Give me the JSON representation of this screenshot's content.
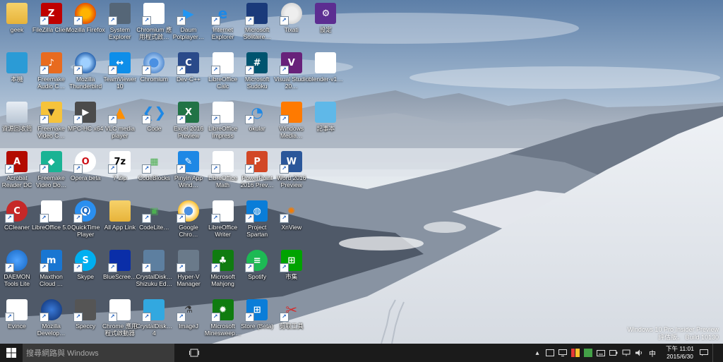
{
  "desktop_icons": [
    {
      "label": "geek",
      "kind": "folder",
      "col": 0,
      "row": 0,
      "shortcut": false
    },
    {
      "label": "FileZilla Client",
      "kind": "filezilla",
      "col": 1,
      "row": 0,
      "shortcut": true
    },
    {
      "label": "Mozilla Firefox",
      "kind": "firefox",
      "col": 2,
      "row": 0,
      "shortcut": true
    },
    {
      "label": "System Explorer",
      "kind": "sysexp",
      "col": 3,
      "row": 0,
      "shortcut": true
    },
    {
      "label": "Chromium 應用程式啟…",
      "kind": "grid",
      "col": 4,
      "row": 0,
      "shortcut": true
    },
    {
      "label": "Daum Potplayer…",
      "kind": "play",
      "col": 5,
      "row": 0,
      "shortcut": true
    },
    {
      "label": "Internet Explorer",
      "kind": "ie",
      "col": 6,
      "row": 0,
      "shortcut": true
    },
    {
      "label": "Microsoft Solitaire…",
      "kind": "cards",
      "col": 7,
      "row": 0,
      "shortcut": true
    },
    {
      "label": "Tixati",
      "kind": "tixati",
      "col": 8,
      "row": 0,
      "shortcut": true
    },
    {
      "label": "設定",
      "kind": "gear",
      "col": 9,
      "row": 0,
      "shortcut": false
    },
    {
      "label": "本機",
      "kind": "pc",
      "col": 0,
      "row": 1,
      "shortcut": false
    },
    {
      "label": "Freemake Audio C…",
      "kind": "freemake-audio",
      "col": 1,
      "row": 1,
      "shortcut": true
    },
    {
      "label": "Mozilla Thunderbird",
      "kind": "thunderbird",
      "col": 2,
      "row": 1,
      "shortcut": true
    },
    {
      "label": "TeamViewer 10",
      "kind": "teamviewer",
      "col": 3,
      "row": 1,
      "shortcut": true
    },
    {
      "label": "Chromium",
      "kind": "chromium",
      "col": 4,
      "row": 1,
      "shortcut": true
    },
    {
      "label": "Dev-C++",
      "kind": "devcpp",
      "col": 5,
      "row": 1,
      "shortcut": true
    },
    {
      "label": "LibreOffice Calc",
      "kind": "calc",
      "col": 6,
      "row": 1,
      "shortcut": true
    },
    {
      "label": "Microsoft Sudoku",
      "kind": "sudoku",
      "col": 7,
      "row": 1,
      "shortcut": true
    },
    {
      "label": "Visual Studio 20…",
      "kind": "vs",
      "col": 8,
      "row": 1,
      "shortcut": true
    },
    {
      "label": "blender-v1…",
      "kind": "file",
      "col": 9,
      "row": 1,
      "shortcut": false
    },
    {
      "label": "資源回收筒",
      "kind": "recycle",
      "col": 0,
      "row": 2,
      "shortcut": false
    },
    {
      "label": "Freemake Video C…",
      "kind": "freemake-video",
      "col": 1,
      "row": 2,
      "shortcut": true
    },
    {
      "label": "MPC-HC x64",
      "kind": "mpc",
      "col": 2,
      "row": 2,
      "shortcut": true
    },
    {
      "label": "VLC media player",
      "kind": "vlc",
      "col": 3,
      "row": 2,
      "shortcut": true
    },
    {
      "label": "Code",
      "kind": "vscode",
      "col": 4,
      "row": 2,
      "shortcut": true
    },
    {
      "label": "Excel 2016 Preview",
      "kind": "excel",
      "col": 5,
      "row": 2,
      "shortcut": true
    },
    {
      "label": "LibreOffice Impress",
      "kind": "impress",
      "col": 6,
      "row": 2,
      "shortcut": true
    },
    {
      "label": "okular",
      "kind": "okular",
      "col": 7,
      "row": 2,
      "shortcut": true
    },
    {
      "label": "Windows Media…",
      "kind": "wmp",
      "col": 8,
      "row": 2,
      "shortcut": true
    },
    {
      "label": "記事本",
      "kind": "notepad",
      "col": 9,
      "row": 2,
      "shortcut": false
    },
    {
      "label": "Acrobat Reader DC",
      "kind": "acrobat",
      "col": 0,
      "row": 3,
      "shortcut": true
    },
    {
      "label": "Freemake Video Do…",
      "kind": "freemake-dl",
      "col": 1,
      "row": 3,
      "shortcut": true
    },
    {
      "label": "Opera beta",
      "kind": "opera",
      "col": 2,
      "row": 3,
      "shortcut": true
    },
    {
      "label": "7-Zip",
      "kind": "7zip",
      "col": 3,
      "row": 3,
      "shortcut": true
    },
    {
      "label": "CodeBlocks",
      "kind": "codeblocks",
      "col": 4,
      "row": 3,
      "shortcut": true
    },
    {
      "label": "Pinyin App Wind…",
      "kind": "pinyin",
      "col": 5,
      "row": 3,
      "shortcut": true
    },
    {
      "label": "LibreOffice Math",
      "kind": "math",
      "col": 6,
      "row": 3,
      "shortcut": true
    },
    {
      "label": "PowerPoint 2016 Prev…",
      "kind": "powerpoint",
      "col": 7,
      "row": 3,
      "shortcut": true
    },
    {
      "label": "Word 2016 Preview",
      "kind": "word",
      "col": 8,
      "row": 3,
      "shortcut": true
    },
    {
      "label": "CCleaner",
      "kind": "ccleaner",
      "col": 0,
      "row": 4,
      "shortcut": true
    },
    {
      "label": "LibreOffice 5.0",
      "kind": "libre",
      "col": 1,
      "row": 4,
      "shortcut": true
    },
    {
      "label": "QuickTime Player",
      "kind": "quicktime",
      "col": 2,
      "row": 4,
      "shortcut": true
    },
    {
      "label": "All App Link",
      "kind": "folder",
      "col": 3,
      "row": 4,
      "shortcut": false
    },
    {
      "label": "CodeLite…",
      "kind": "codelite",
      "col": 4,
      "row": 4,
      "shortcut": true
    },
    {
      "label": "Google Chro…",
      "kind": "chrome",
      "col": 5,
      "row": 4,
      "shortcut": true
    },
    {
      "label": "LibreOffice Writer",
      "kind": "writer",
      "col": 6,
      "row": 4,
      "shortcut": true
    },
    {
      "label": "Project Spartan",
      "kind": "spartan",
      "col": 7,
      "row": 4,
      "shortcut": true
    },
    {
      "label": "XnView",
      "kind": "xnview",
      "col": 8,
      "row": 4,
      "shortcut": true
    },
    {
      "label": "DAEMON Tools Lite",
      "kind": "daemon",
      "col": 0,
      "row": 5,
      "shortcut": true
    },
    {
      "label": "Maxthon Cloud …",
      "kind": "maxthon",
      "col": 1,
      "row": 5,
      "shortcut": true
    },
    {
      "label": "Skype",
      "kind": "skype",
      "col": 2,
      "row": 5,
      "shortcut": true
    },
    {
      "label": "BlueScree…",
      "kind": "bluescreen",
      "col": 3,
      "row": 5,
      "shortcut": true
    },
    {
      "label": "CrystalDisk… Shizuku Ed…",
      "kind": "crystal",
      "col": 4,
      "row": 5,
      "shortcut": true
    },
    {
      "label": "Hyper-V Manager",
      "kind": "hyperv",
      "col": 5,
      "row": 5,
      "shortcut": true
    },
    {
      "label": "Microsoft Mahjong",
      "kind": "mahjong",
      "col": 6,
      "row": 5,
      "shortcut": true
    },
    {
      "label": "Spotify",
      "kind": "spotify",
      "col": 7,
      "row": 5,
      "shortcut": true
    },
    {
      "label": "市集",
      "kind": "store",
      "col": 8,
      "row": 5,
      "shortcut": true
    },
    {
      "label": "Evince",
      "kind": "evince",
      "col": 0,
      "row": 6,
      "shortcut": true
    },
    {
      "label": "Mozilla Develop…",
      "kind": "mozdev",
      "col": 1,
      "row": 6,
      "shortcut": true
    },
    {
      "label": "Speccy",
      "kind": "speccy",
      "col": 2,
      "row": 6,
      "shortcut": true
    },
    {
      "label": "Chrome 應用程式啟動器",
      "kind": "grid",
      "col": 3,
      "row": 6,
      "shortcut": true
    },
    {
      "label": "CrystalDisk… 4",
      "kind": "crystal2",
      "col": 4,
      "row": 6,
      "shortcut": true
    },
    {
      "label": "ImageJ",
      "kind": "imagej",
      "col": 5,
      "row": 6,
      "shortcut": true
    },
    {
      "label": "Microsoft Minesweep…",
      "kind": "minesweeper",
      "col": 6,
      "row": 6,
      "shortcut": true
    },
    {
      "label": "Store (Beta)",
      "kind": "storebeta",
      "col": 7,
      "row": 6,
      "shortcut": true
    },
    {
      "label": "剪取工具",
      "kind": "snip",
      "col": 8,
      "row": 6,
      "shortcut": true
    }
  ],
  "watermark": {
    "line1": "Windows 10 Pro Insider Preview",
    "line2": "評估版。 Build 10130"
  },
  "taskbar": {
    "search_placeholder": "搜尋網路與 Windows",
    "clock_time": "下午 11:01",
    "clock_date": "2015/6/30",
    "ime_label": "中"
  },
  "colors": {
    "taskbar_bg": "#1b1b1b",
    "search_bg": "#3a3a3a",
    "windows_blue": "#1e88e5"
  }
}
